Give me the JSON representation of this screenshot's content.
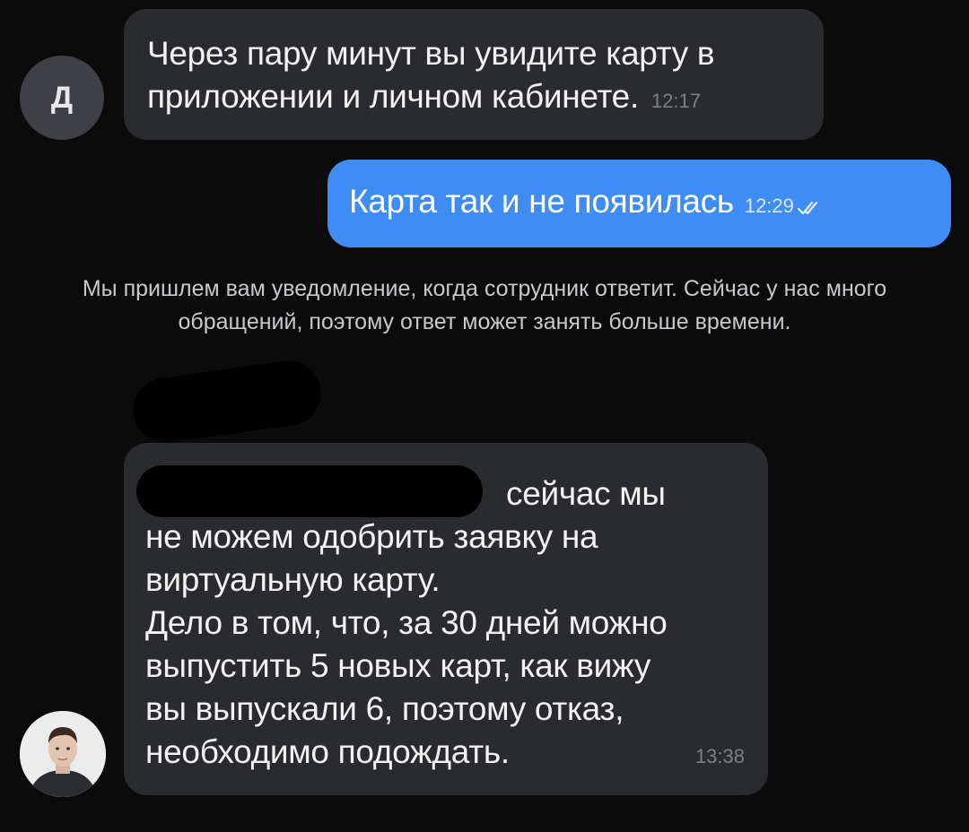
{
  "messages": [
    {
      "sender_initial": "Д",
      "text": "Через пару минут вы увидите карту в приложении и личном кабинете.",
      "time": "12:17"
    },
    {
      "text": "Карта так и не появилась",
      "time": "12:29",
      "status_icon": "double-check-icon"
    },
    {
      "lines": [
        "сейчас мы",
        "не можем одобрить заявку на",
        "виртуальную карту.",
        "Дело в том, что, за 30 дней можно",
        "выпустить 5 новых карт, как вижу",
        "вы выпускали 6, поэтому отказ,",
        "необходимо подождать."
      ],
      "time": "13:38",
      "avatar_icon": "operator-photo-icon"
    }
  ],
  "system_note": "Мы пришлем вам уведомление, когда сотрудник ответит. Сейчас у нас много обращений, поэтому ответ может занять больше времени.",
  "colors": {
    "background": "#0b0b0c",
    "incoming_bubble": "#2a2b2f",
    "outgoing_bubble": "#3f8cf5"
  }
}
